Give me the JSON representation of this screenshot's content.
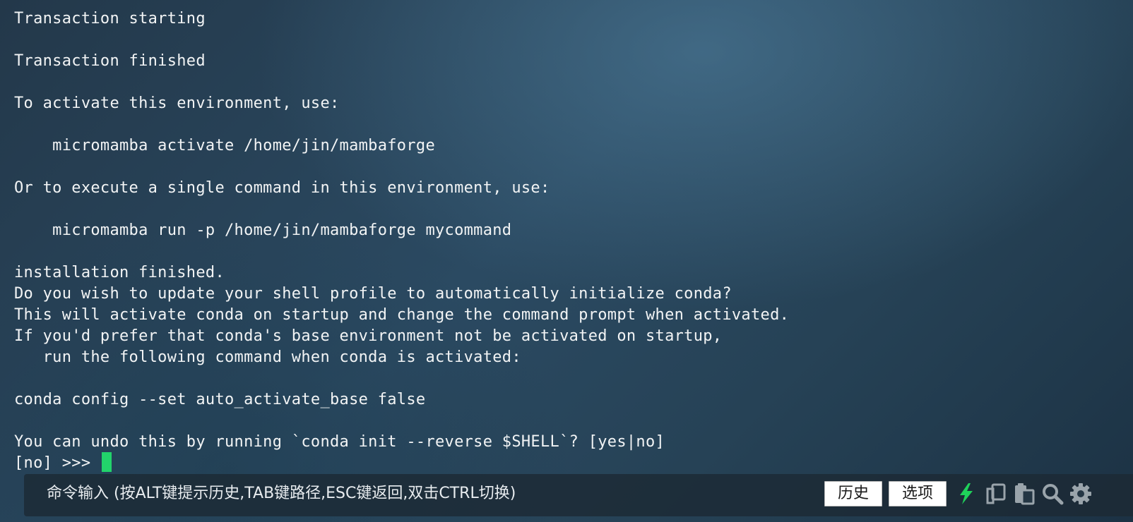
{
  "terminal": {
    "lines": [
      "Transaction starting",
      "",
      "Transaction finished",
      "",
      "To activate this environment, use:",
      "",
      "    micromamba activate /home/jin/mambaforge",
      "",
      "Or to execute a single command in this environment, use:",
      "",
      "    micromamba run -p /home/jin/mambaforge mycommand",
      "",
      "installation finished.",
      "Do you wish to update your shell profile to automatically initialize conda?",
      "This will activate conda on startup and change the command prompt when activated.",
      "If you'd prefer that conda's base environment not be activated on startup,",
      "   run the following command when conda is activated:",
      "",
      "conda config --set auto_activate_base false",
      "",
      "You can undo this by running `conda init --reverse $SHELL`? [yes|no]"
    ],
    "prompt": "[no] >>> "
  },
  "bottom_bar": {
    "hint": "命令输入 (按ALT键提示历史,TAB键路径,ESC键返回,双击CTRL切换)",
    "history_label": "历史",
    "options_label": "选项",
    "icons": [
      "lightning-icon",
      "copy-icon",
      "clipboard-icon",
      "search-icon",
      "gear-icon"
    ]
  },
  "colors": {
    "cursor": "#22d36b",
    "lightning": "#1fd15a",
    "icon_gray": "#9aa4ab"
  }
}
